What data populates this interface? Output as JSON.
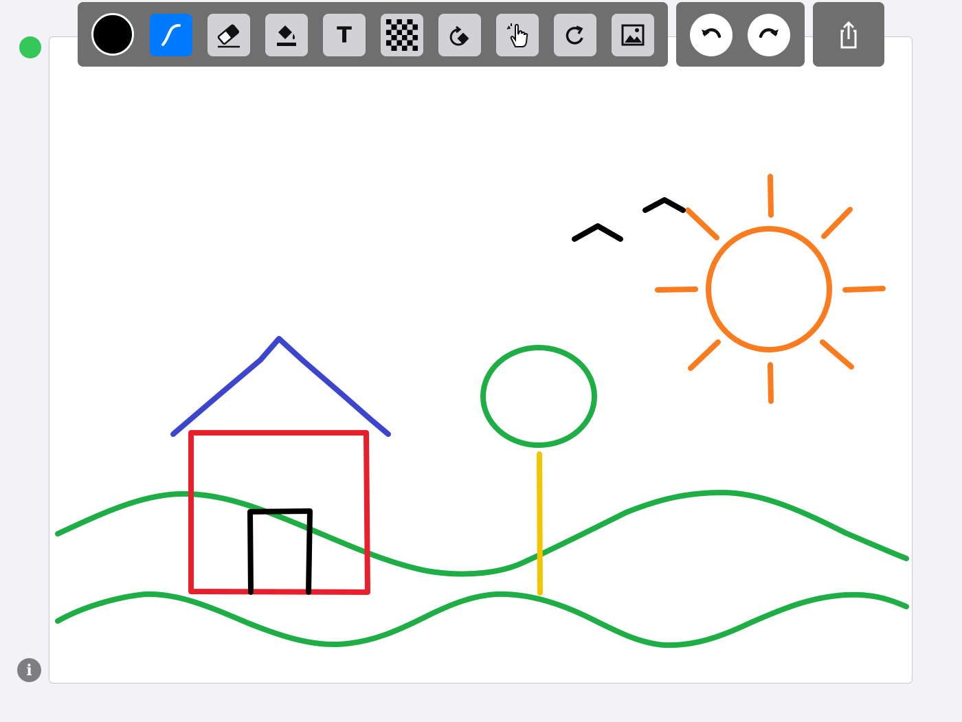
{
  "app": {
    "status_color": "#34c759",
    "canvas_background": "#ffffff"
  },
  "toolbar": {
    "current_color": "#000000",
    "tools": [
      {
        "name": "color-picker",
        "icon": "color-swatch",
        "selected": false
      },
      {
        "name": "pen",
        "icon": "pen-icon",
        "selected": true
      },
      {
        "name": "eraser",
        "icon": "eraser-icon",
        "selected": false
      },
      {
        "name": "fill",
        "icon": "paint-bucket-icon",
        "selected": false
      },
      {
        "name": "text",
        "icon": "text-icon",
        "label": "T",
        "selected": false
      },
      {
        "name": "pattern",
        "icon": "checkerboard-icon",
        "selected": false
      },
      {
        "name": "transform",
        "icon": "rotate-shape-icon",
        "selected": false
      },
      {
        "name": "gesture",
        "icon": "hand-sparkle-icon",
        "selected": false
      },
      {
        "name": "refresh",
        "icon": "refresh-icon",
        "selected": false
      },
      {
        "name": "image",
        "icon": "image-icon",
        "selected": false
      }
    ],
    "history": [
      {
        "name": "undo",
        "icon": "undo-icon"
      },
      {
        "name": "redo",
        "icon": "redo-icon"
      }
    ],
    "share": {
      "icon": "share-icon"
    }
  },
  "info": {
    "icon": "info-icon",
    "label": "i"
  },
  "drawing": {
    "strokes": [
      {
        "name": "hill-upper",
        "color": "#1fad45"
      },
      {
        "name": "hill-lower",
        "color": "#1fad45"
      },
      {
        "name": "house-roof",
        "color": "#3c45cc"
      },
      {
        "name": "house-wall",
        "color": "#e8202e"
      },
      {
        "name": "house-door",
        "color": "#000000"
      },
      {
        "name": "tree-crown",
        "color": "#1fad45"
      },
      {
        "name": "tree-trunk",
        "color": "#f5c400"
      },
      {
        "name": "sun",
        "color": "#fa7c1e"
      },
      {
        "name": "bird",
        "color": "#000000"
      }
    ]
  }
}
